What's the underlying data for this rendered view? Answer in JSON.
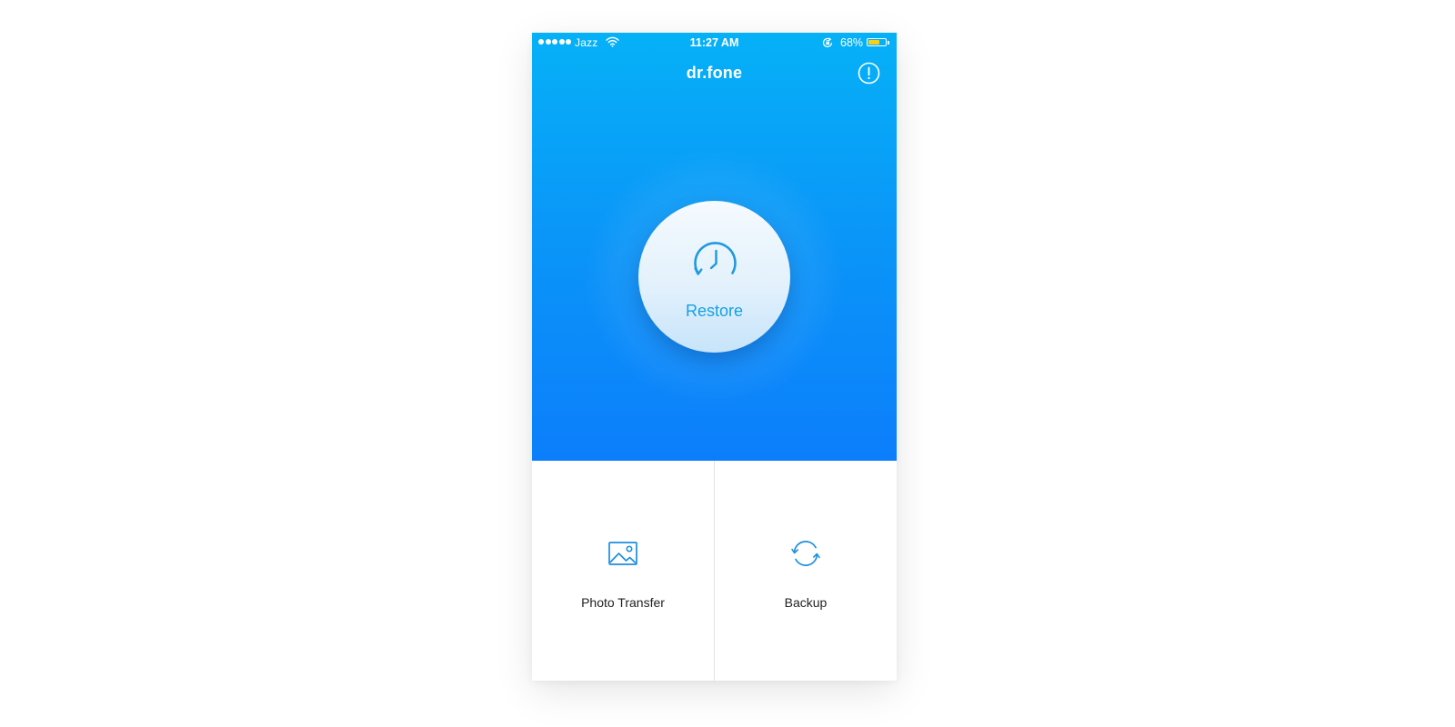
{
  "status_bar": {
    "carrier": "Jazz",
    "time": "11:27 AM",
    "battery_percent": "68%",
    "battery_level": 0.68,
    "signal_bars": 5
  },
  "header": {
    "title": "dr.fone",
    "info_icon": "info-circle-icon"
  },
  "main_action": {
    "label": "Restore",
    "icon": "clock-restore-icon"
  },
  "tiles": [
    {
      "label": "Photo Transfer",
      "icon": "photo-icon"
    },
    {
      "label": "Backup",
      "icon": "sync-icon"
    }
  ],
  "colors": {
    "gradient_top": "#06b1f7",
    "gradient_bottom": "#0c7efb",
    "accent": "#17a0e3",
    "battery": "#f7d117"
  }
}
